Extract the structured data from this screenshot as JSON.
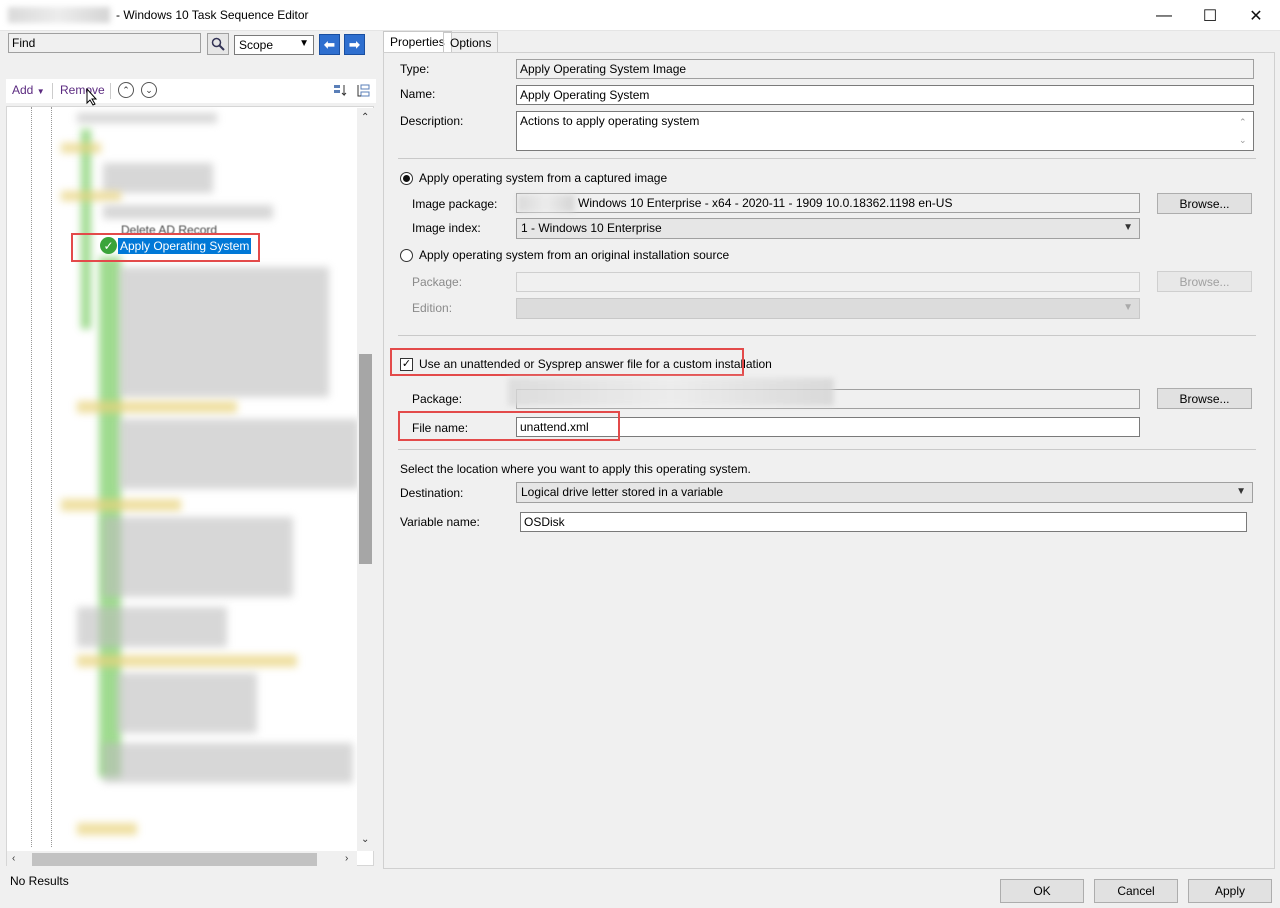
{
  "window": {
    "title": "- Windows 10 Task Sequence Editor",
    "controls": {
      "minimize": "—",
      "maximize": "☐",
      "close": "✕"
    }
  },
  "search": {
    "placeholder": "Find",
    "value": "Find",
    "scope": "Scope"
  },
  "toolbar": {
    "add_label": "Add",
    "remove_label": "Remove"
  },
  "tree": {
    "selected_item": "Apply Operating System",
    "partial_item": "Delete AD Record"
  },
  "status_bar": {
    "text": "No Results"
  },
  "tabs": [
    {
      "label": "Properties",
      "active": true
    },
    {
      "label": "Options",
      "active": false
    }
  ],
  "properties": {
    "type_label": "Type:",
    "type_value": "Apply Operating System Image",
    "name_label": "Name:",
    "name_value": "Apply Operating System",
    "description_label": "Description:",
    "description_value": "Actions to apply operating system",
    "captured_image_option": {
      "label": "Apply operating system from a captured image",
      "selected": true
    },
    "image_package_label": "Image package:",
    "image_package_value": "Windows 10 Enterprise - x64 - 2020-11 - 1909 10.0.18362.1198 en-US",
    "image_index_label": "Image index:",
    "image_index_value": "1 - Windows 10 Enterprise",
    "browse_label": "Browse...",
    "original_source_option": {
      "label": "Apply operating system from an original installation source",
      "selected": false
    },
    "package_label": "Package:",
    "edition_label": "Edition:",
    "answer_file": {
      "label": "Use an unattended or Sysprep answer file for a custom installation",
      "checked": true
    },
    "answer_package_label": "Package:",
    "file_name_label": "File name:",
    "file_name_value": "unattend.xml",
    "location_prompt": "Select the location where you want to apply this operating system.",
    "destination_label": "Destination:",
    "destination_value": "Logical drive letter stored in a variable",
    "variable_name_label": "Variable name:",
    "variable_name_value": "OSDisk"
  },
  "dialog_buttons": {
    "ok": "OK",
    "cancel": "Cancel",
    "apply": "Apply"
  },
  "colors": {
    "selection": "#0078d7",
    "highlight_box": "#e34a4a",
    "nav_arrow": "#2f6fcf"
  }
}
